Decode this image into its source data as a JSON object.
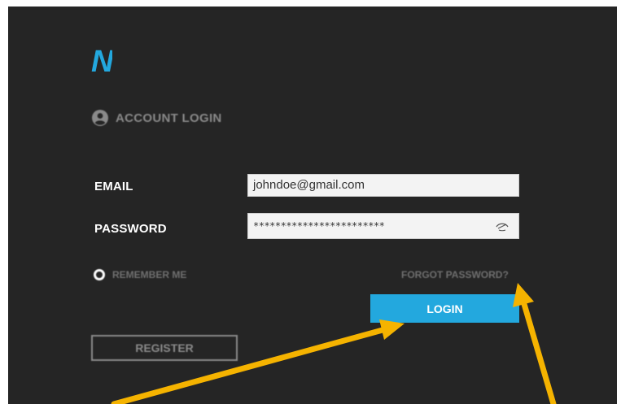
{
  "brand": {
    "logo_letter": "N",
    "logo_color": "#23a8de"
  },
  "header": {
    "title": "ACCOUNT LOGIN",
    "icon": "user-circle-icon"
  },
  "form": {
    "email_label": "EMAIL",
    "email_value": "johndoe@gmail.com",
    "password_label": "PASSWORD",
    "password_value": "************************",
    "password_toggle_icon": "eye-icon"
  },
  "options": {
    "remember_label": "REMEMBER ME",
    "forgot_label": "FORGOT PASSWORD?"
  },
  "actions": {
    "login_label": "LOGIN",
    "register_label": "REGISTER"
  },
  "colors": {
    "background": "#252525",
    "accent": "#23a8de",
    "annotation_arrow": "#f5b300"
  }
}
